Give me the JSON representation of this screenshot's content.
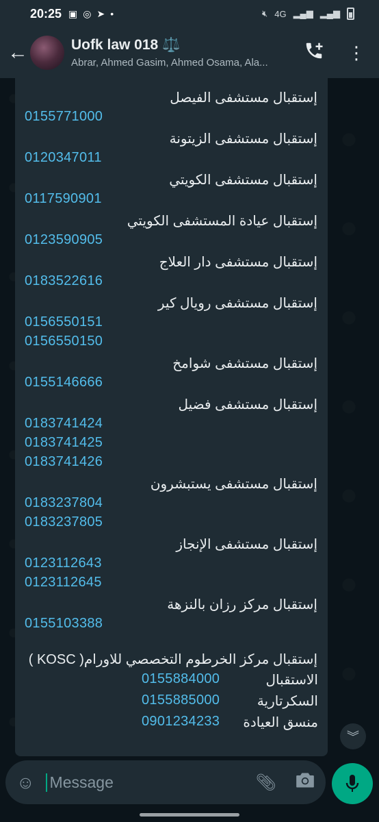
{
  "status": {
    "time": "20:25",
    "network": "4G"
  },
  "header": {
    "title": "Uofk law 018 ⚖️",
    "subtitle": "Abrar, Ahmed Gasim, Ahmed Osama, Ala..."
  },
  "messages": [
    {
      "type": "ar",
      "text": "إستقبال مستشفى الفيصل"
    },
    {
      "type": "ph",
      "text": "0155771000"
    },
    {
      "type": "ar",
      "text": "إستقبال مستشفى الزيتونة"
    },
    {
      "type": "ph",
      "text": "0120347011"
    },
    {
      "type": "ar",
      "text": "إستقبال مستشفى الكويتي"
    },
    {
      "type": "ph",
      "text": "0117590901"
    },
    {
      "type": "ar",
      "text": "إستقبال عيادة المستشفى الكويتي"
    },
    {
      "type": "ph",
      "text": "0123590905"
    },
    {
      "type": "ar",
      "text": "إستقبال مستشفى دار العلاج"
    },
    {
      "type": "ph",
      "text": "0183522616"
    },
    {
      "type": "ar",
      "text": "إستقبال مستشفى رويال كير"
    },
    {
      "type": "ph",
      "text": "0156550151"
    },
    {
      "type": "ph",
      "text": "0156550150"
    },
    {
      "type": "ar",
      "text": "إستقبال مستشفى شوامخ"
    },
    {
      "type": "ph",
      "text": "0155146666"
    },
    {
      "type": "ar",
      "text": "إستقبال مستشفى فضيل"
    },
    {
      "type": "ph",
      "text": "0183741424"
    },
    {
      "type": "ph",
      "text": "0183741425"
    },
    {
      "type": "ph",
      "text": "0183741426"
    },
    {
      "type": "ar",
      "text": "إستقبال مستشفى يستبشرون"
    },
    {
      "type": "ph",
      "text": "0183237804"
    },
    {
      "type": "ph",
      "text": "0183237805"
    },
    {
      "type": "ar",
      "text": "إستقبال مستشفى الإنجاز"
    },
    {
      "type": "ph",
      "text": "0123112643"
    },
    {
      "type": "ph",
      "text": "0123112645"
    },
    {
      "type": "ar",
      "text": "إستقبال مركز رزان بالنزهة"
    },
    {
      "type": "ph",
      "text": "0155103388"
    },
    {
      "type": "ar",
      "text": "إستقبال مركز الخرطوم التخصصي للاورام( KOSC )"
    }
  ],
  "kosc": [
    {
      "label": "الاستقبال",
      "phone": "0155884000"
    },
    {
      "label": "السكرتارية",
      "phone": "0155885000"
    },
    {
      "label": "منسق العيادة",
      "phone": "0901234233"
    }
  ],
  "input": {
    "placeholder": "Message"
  },
  "colors": {
    "link": "#53bdeb",
    "accent": "#00a884",
    "bubble": "#1f2c34",
    "background": "#0b141a"
  }
}
